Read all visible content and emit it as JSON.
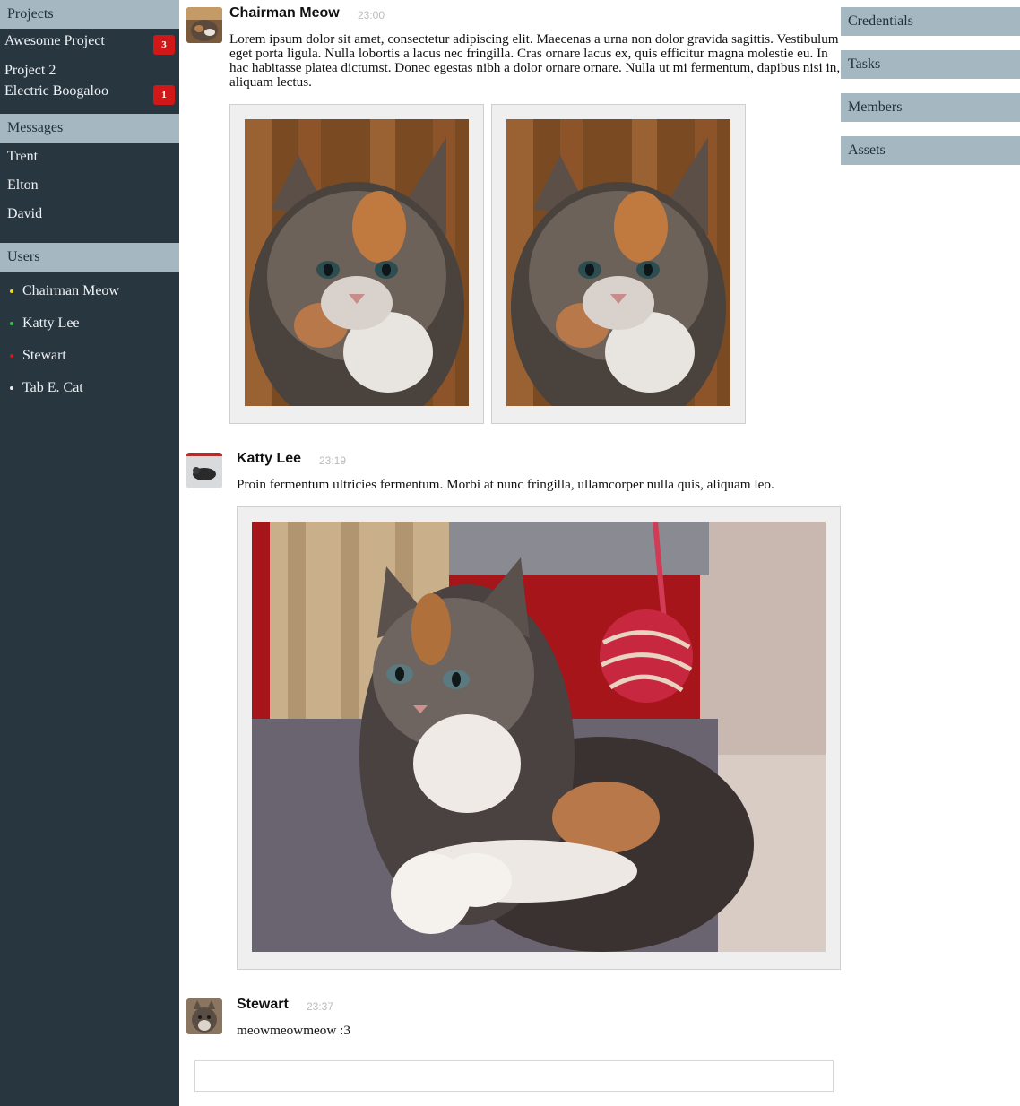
{
  "sidebar": {
    "projects_header": "Projects",
    "projects": [
      {
        "label": "Awesome Project",
        "badge": "3"
      },
      {
        "label": "Project 2",
        "badge": ""
      },
      {
        "label": "Electric Boogaloo",
        "badge": "1"
      }
    ],
    "messages_header": "Messages",
    "messages": [
      "Trent",
      "Elton",
      "David"
    ],
    "users_header": "Users",
    "users": [
      {
        "name": "Chairman Meow",
        "status_color": "#f5d90a"
      },
      {
        "name": "Katty Lee",
        "status_color": "#2ecc40"
      },
      {
        "name": "Stewart",
        "status_color": "#d01818"
      },
      {
        "name": "Tab E. Cat",
        "status_color": "#e8ecee"
      }
    ]
  },
  "right_panel": {
    "buttons": [
      "Credentials",
      "Tasks",
      "Members",
      "Assets"
    ]
  },
  "chat": {
    "messages": [
      {
        "author": "Chairman Meow",
        "time": "23:00",
        "text": "Lorem ipsum dolor sit amet, consectetur adipiscing elit. Maecenas a urna non dolor gravida sagittis. Vestibulum eget porta ligula. Nulla lobortis a lacus nec fringilla. Cras ornare lacus ex, quis efficitur magna molestie eu. In hac habitasse platea dictumst. Donec egestas nibh a dolor ornare ornare. Nulla ut mi fermentum, dapibus nisi in, aliquam lectus.",
        "attachments": [
          "kitten-photo",
          "kitten-photo"
        ]
      },
      {
        "author": "Katty Lee",
        "time": "23:19",
        "text": "Proin fermentum ultricies fermentum. Morbi at nunc fringilla, ullamcorper nulla quis, aliquam leo.",
        "attachments": [
          "kitten-with-yarn-ball-photo"
        ]
      },
      {
        "author": "Stewart",
        "time": "23:37",
        "text": "meowmeowmeow :3",
        "attachments": []
      }
    ],
    "input_placeholder": ""
  },
  "colors": {
    "sidebar_bg": "#283640",
    "header_bg": "#a5b8c1",
    "badge_red": "#d01818",
    "attachment_frame": "#efefef"
  }
}
